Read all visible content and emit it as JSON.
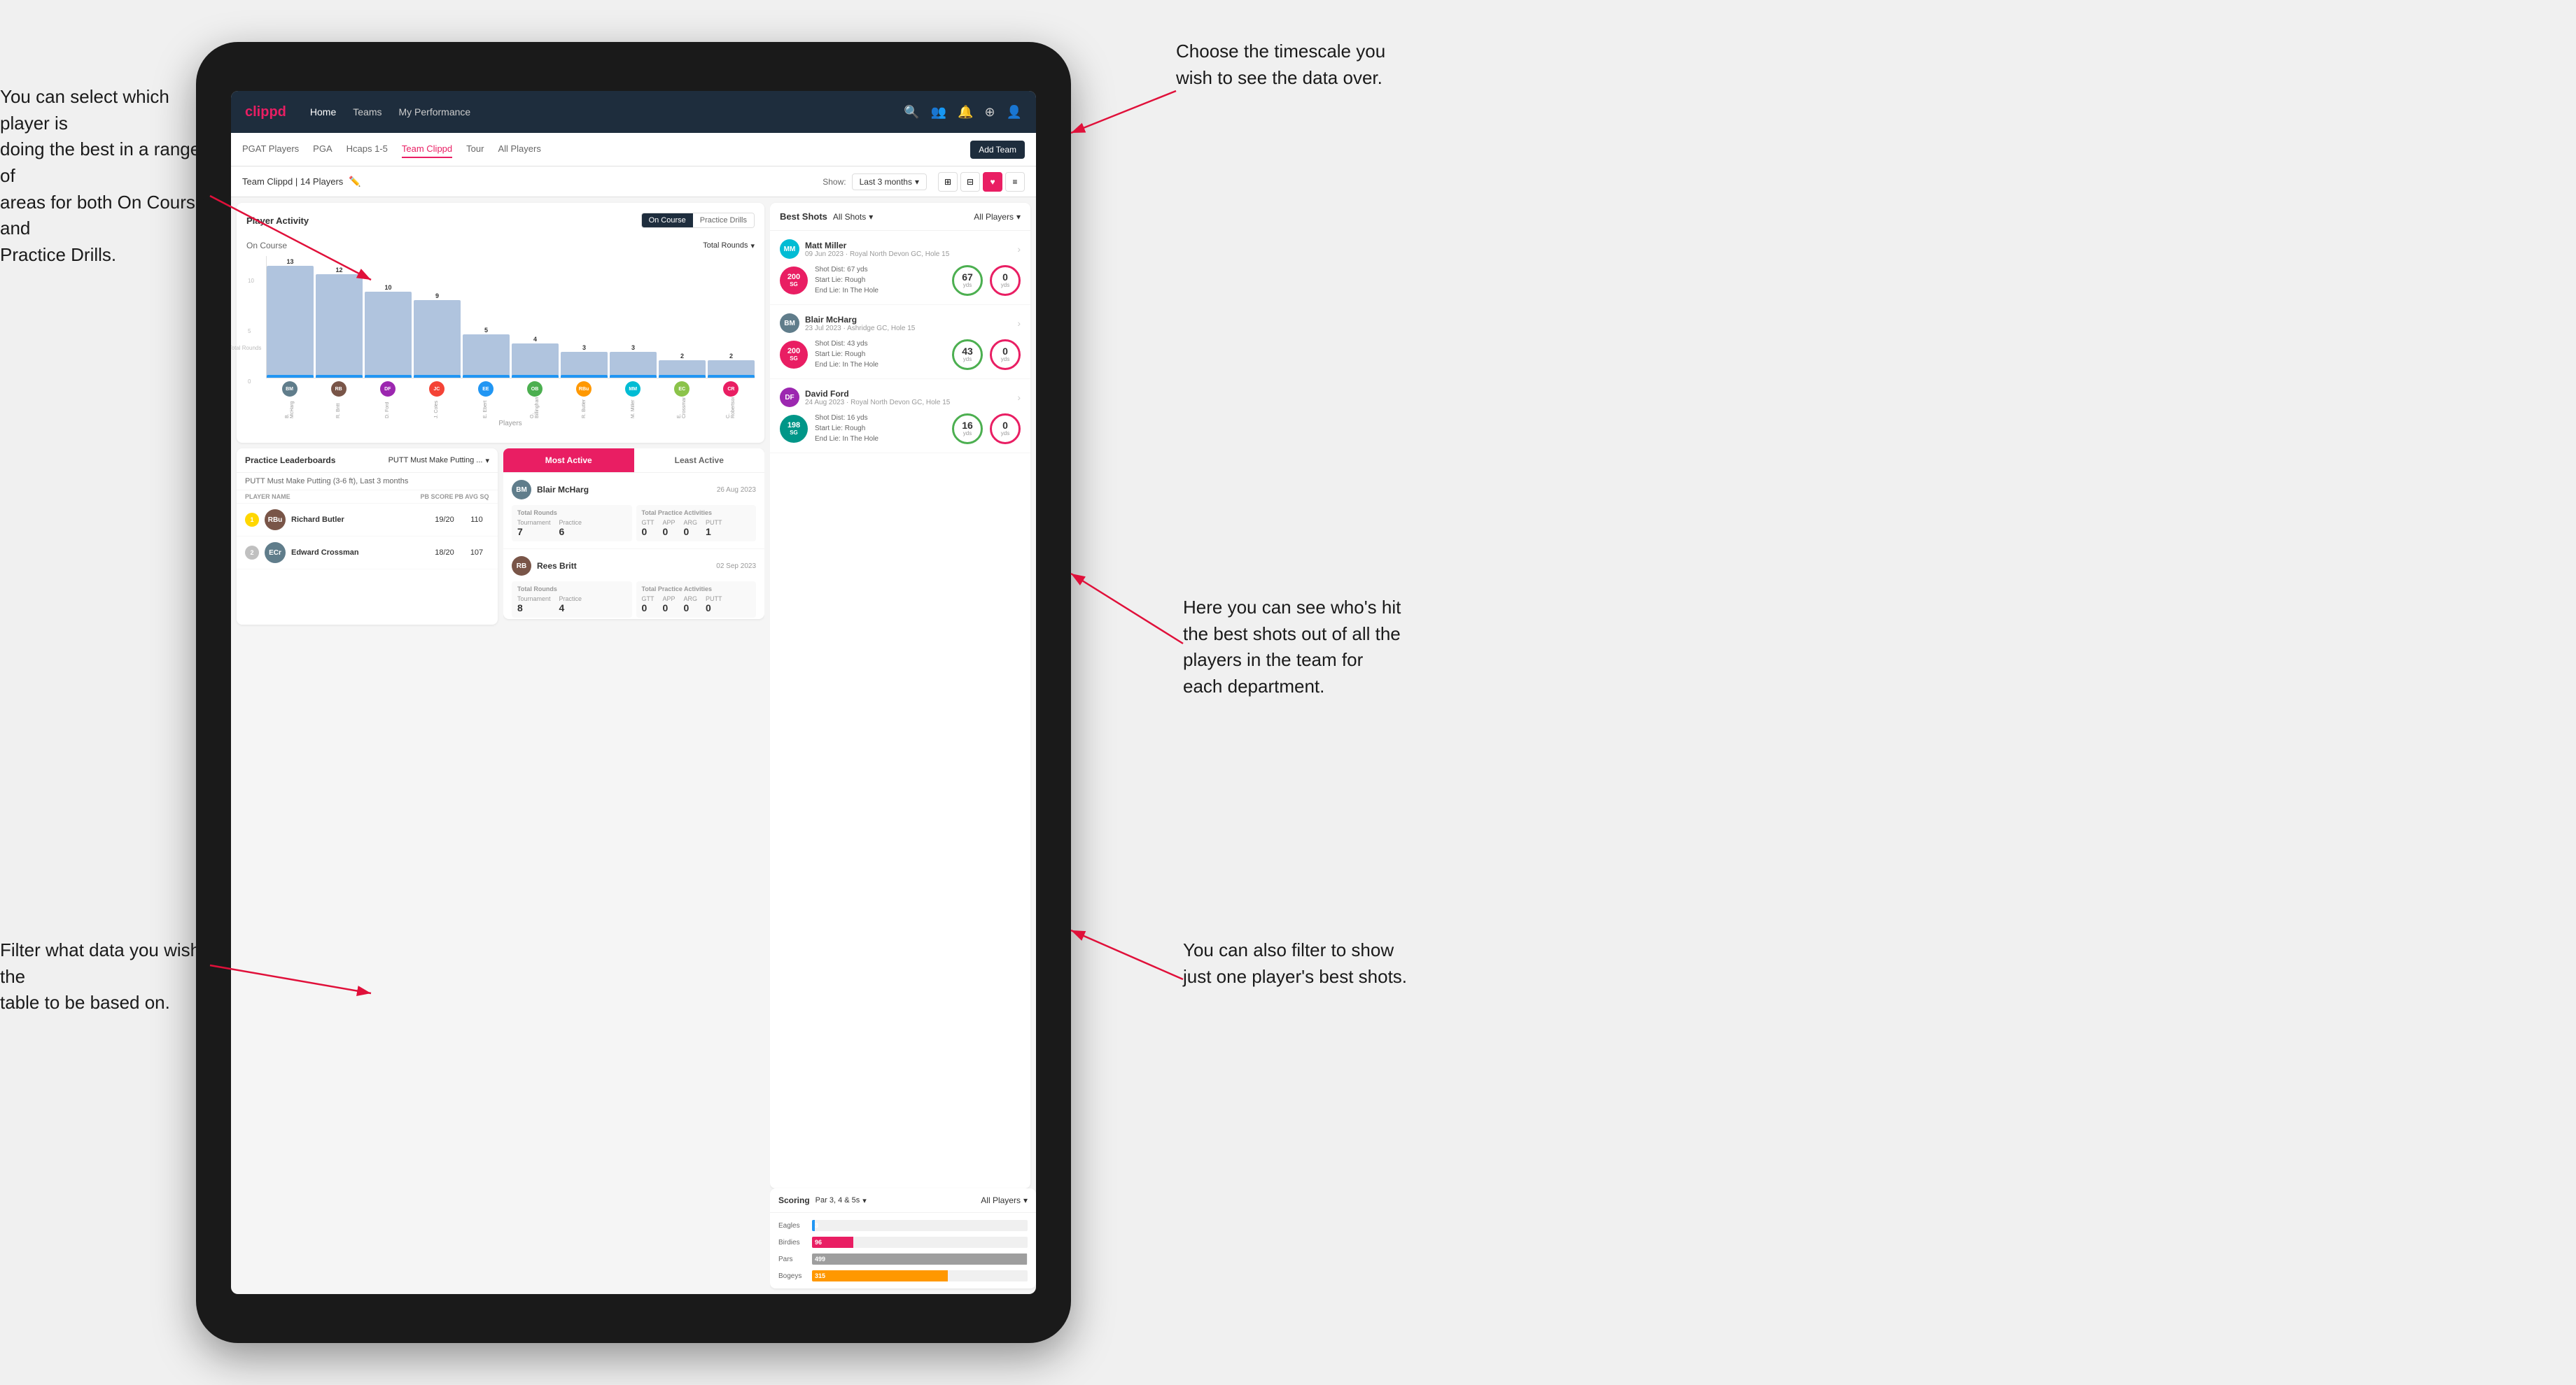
{
  "annotations": {
    "top_right": {
      "title": "Choose the timescale you\nwish to see the data over."
    },
    "top_left": {
      "title": "You can select which player is\ndoing the best in a range of\nareas for both On Course and\nPractice Drills."
    },
    "bottom_left": {
      "title": "Filter what data you wish the\ntable to be based on."
    },
    "bottom_right_1": {
      "title": "Here you can see who's hit\nthe best shots out of all the\nplayers in the team for\neach department."
    },
    "bottom_right_2": {
      "title": "You can also filter to show\njust one player's best shots."
    }
  },
  "navbar": {
    "logo": "clippd",
    "items": [
      "Home",
      "Teams",
      "My Performance"
    ],
    "active_item": "My Performance"
  },
  "subtabs": {
    "items": [
      "PGAT Players",
      "PGA",
      "Hcaps 1-5",
      "Team Clippd",
      "Tour",
      "All Players"
    ],
    "active": "Team Clippd",
    "add_button": "Add Team"
  },
  "team_header": {
    "name": "Team Clippd | 14 Players",
    "show_label": "Show:",
    "show_value": "Last 3 months"
  },
  "player_activity": {
    "title": "Player Activity",
    "toggle_options": [
      "On Course",
      "Practice Drills"
    ],
    "active_toggle": "On Course",
    "section_title": "On Course",
    "chart_dropdown": "Total Rounds",
    "y_label": "Total Rounds",
    "players_label": "Players",
    "bars": [
      {
        "name": "B. McHarg",
        "value": 13,
        "initials": "BM",
        "color": "#607D8B"
      },
      {
        "name": "R. Britt",
        "value": 12,
        "initials": "RB",
        "color": "#795548"
      },
      {
        "name": "D. Ford",
        "value": 10,
        "initials": "DF",
        "color": "#9C27B0"
      },
      {
        "name": "J. Coles",
        "value": 9,
        "initials": "JC",
        "color": "#F44336"
      },
      {
        "name": "E. Ebert",
        "value": 5,
        "initials": "EE",
        "color": "#2196F3"
      },
      {
        "name": "O. Billingham",
        "value": 4,
        "initials": "OB",
        "color": "#4CAF50"
      },
      {
        "name": "R. Butler",
        "value": 3,
        "initials": "RBu",
        "color": "#FF9800"
      },
      {
        "name": "M. Miller",
        "value": 3,
        "initials": "MM",
        "color": "#00BCD4"
      },
      {
        "name": "E. Crossman",
        "value": 2,
        "initials": "EC",
        "color": "#8BC34A"
      },
      {
        "name": "C. Robertson",
        "value": 2,
        "initials": "CR",
        "color": "#E91E63"
      }
    ]
  },
  "best_shots": {
    "title": "Best Shots",
    "shots_filter": "All Shots",
    "players_filter": "All Players",
    "players_filter_team": "All Players",
    "players": [
      {
        "name": "Matt Miller",
        "date": "09 Jun 2023",
        "course": "Royal North Devon GC",
        "hole": "Hole 15",
        "badge_num": "200",
        "badge_label": "SG",
        "badge_color": "pink",
        "shot_dist": "Shot Dist: 67 yds",
        "start_lie": "Start Lie: Rough",
        "end_lie": "End Lie: In The Hole",
        "stat1_num": "67",
        "stat1_unit": "yds",
        "stat1_color": "green",
        "stat2_num": "0",
        "stat2_unit": "yds",
        "stat2_color": "red"
      },
      {
        "name": "Blair McHarg",
        "date": "23 Jul 2023",
        "course": "Ashridge GC",
        "hole": "Hole 15",
        "badge_num": "200",
        "badge_label": "SG",
        "badge_color": "pink",
        "shot_dist": "Shot Dist: 43 yds",
        "start_lie": "Start Lie: Rough",
        "end_lie": "End Lie: In The Hole",
        "stat1_num": "43",
        "stat1_unit": "yds",
        "stat1_color": "green",
        "stat2_num": "0",
        "stat2_unit": "yds",
        "stat2_color": "red"
      },
      {
        "name": "David Ford",
        "date": "24 Aug 2023",
        "course": "Royal North Devon GC",
        "hole": "Hole 15",
        "badge_num": "198",
        "badge_label": "SG",
        "badge_color": "teal",
        "shot_dist": "Shot Dist: 16 yds",
        "start_lie": "Start Lie: Rough",
        "end_lie": "End Lie: In The Hole",
        "stat1_num": "16",
        "stat1_unit": "yds",
        "stat1_color": "green",
        "stat2_num": "0",
        "stat2_unit": "yds",
        "stat2_color": "red"
      }
    ]
  },
  "practice_leaderboards": {
    "title": "Practice Leaderboards",
    "drill_label": "PUTT Must Make Putting ...",
    "subtitle": "PUTT Must Make Putting (3-6 ft), Last 3 months",
    "columns": [
      "PLAYER NAME",
      "PB SCORE",
      "PB AVG SQ"
    ],
    "players": [
      {
        "name": "Richard Butler",
        "initials": "RBu",
        "color": "#795548",
        "rank": 1,
        "pb_score": "19/20",
        "pb_avg": "110"
      },
      {
        "name": "Edward Crossman",
        "initials": "ECr",
        "color": "#607D8B",
        "rank": 2,
        "pb_score": "18/20",
        "pb_avg": "107"
      }
    ]
  },
  "most_active": {
    "tabs": [
      "Most Active",
      "Least Active"
    ],
    "active_tab": "Most Active",
    "players": [
      {
        "name": "Blair McHarg",
        "date": "26 Aug 2023",
        "initials": "BM",
        "color": "#607D8B",
        "total_rounds_label": "Total Rounds",
        "tournament_label": "Tournament",
        "practice_label": "Practice",
        "tournament_val": "7",
        "practice_val": "6",
        "practice_activities_label": "Total Practice Activities",
        "gtt_label": "GTT",
        "app_label": "APP",
        "arg_label": "ARG",
        "putt_label": "PUTT",
        "gtt_val": "0",
        "app_val": "0",
        "arg_val": "0",
        "putt_val": "1"
      },
      {
        "name": "Rees Britt",
        "date": "02 Sep 2023",
        "initials": "RB",
        "color": "#795548",
        "tournament_val": "8",
        "practice_val": "4",
        "gtt_val": "0",
        "app_val": "0",
        "arg_val": "0",
        "putt_val": "0"
      }
    ]
  },
  "scoring": {
    "title": "Scoring",
    "par_filter": "Par 3, 4 & 5s",
    "players_filter": "All Players",
    "bars": [
      {
        "label": "Eagles",
        "value": 3,
        "max": 500,
        "color": "#2196F3"
      },
      {
        "label": "Birdies",
        "value": 96,
        "max": 500,
        "color": "#e91e63"
      },
      {
        "label": "Pars",
        "value": 499,
        "max": 500,
        "color": "#9E9E9E"
      },
      {
        "label": "Bogeys",
        "value": 315,
        "max": 500,
        "color": "#FF9800"
      }
    ]
  }
}
